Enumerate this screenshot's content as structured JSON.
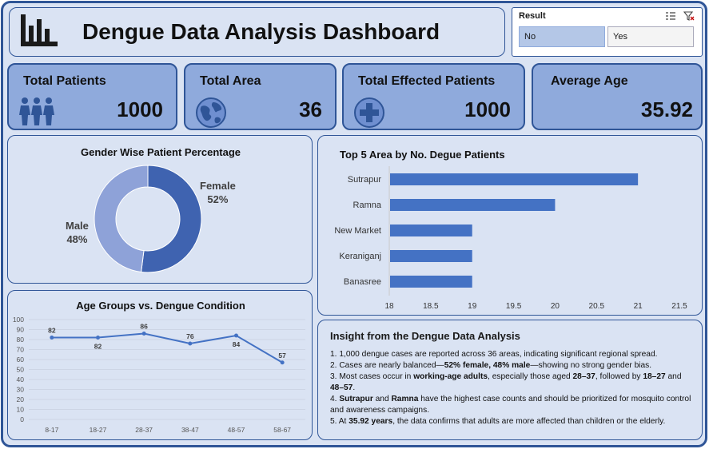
{
  "header": {
    "title": "Dengue Data Analysis Dashboard",
    "icon": "bar-chart-icon"
  },
  "slicer": {
    "title": "Result",
    "options": [
      "No",
      "Yes"
    ],
    "selected": "No",
    "icons": [
      "multi-select-icon",
      "clear-filter-icon"
    ]
  },
  "kpis": [
    {
      "title": "Total Patients",
      "value": "1000",
      "icon": "people-icon"
    },
    {
      "title": "Total Area",
      "value": "36",
      "icon": "globe-icon"
    },
    {
      "title": "Total Effected Patients",
      "value": "1000",
      "icon": "medical-cross-icon"
    },
    {
      "title": "Average Age",
      "value": "35.92",
      "icon": ""
    }
  ],
  "colors": {
    "dark_blue": "#2f5597",
    "mid_blue": "#4472c4",
    "light_blue": "#8faadc",
    "pale_blue": "#dae3f3",
    "donut_female": "#3f63b0",
    "donut_male": "#8ea2d8"
  },
  "chart_data": [
    {
      "type": "pie",
      "subtype": "donut",
      "title": "Gender Wise Patient Percentage",
      "slices": [
        {
          "label": "Female",
          "value": 52,
          "display": "52%"
        },
        {
          "label": "Male",
          "value": 48,
          "display": "48%"
        }
      ]
    },
    {
      "type": "bar",
      "orientation": "horizontal",
      "title": "Top 5 Area by No. Degue Patients",
      "categories": [
        "Sutrapur",
        "Ramna",
        "New Market",
        "Keraniganj",
        "Banasree"
      ],
      "values": [
        21,
        20,
        19,
        19,
        19
      ],
      "xlim": [
        18,
        21.5
      ],
      "xticks": [
        "18",
        "18.5",
        "19",
        "19.5",
        "20",
        "20.5",
        "21",
        "21.5"
      ],
      "grid": false
    },
    {
      "type": "line",
      "title": "Age Groups vs. Dengue Condition",
      "categories": [
        "8-17",
        "18-27",
        "28-37",
        "38-47",
        "48-57",
        "58-67"
      ],
      "values": [
        82,
        82,
        86,
        76,
        84,
        57
      ],
      "ylim": [
        0,
        100
      ],
      "yticks": [
        "0",
        "10",
        "20",
        "30",
        "40",
        "50",
        "60",
        "70",
        "80",
        "90",
        "100"
      ],
      "grid": true
    }
  ],
  "insight": {
    "title": "Insight from the Dengue Data Analysis",
    "lines": [
      {
        "parts": [
          {
            "t": "1. 1,000 dengue cases are reported across 36 areas, indicating significant regional spread.",
            "b": false
          }
        ]
      },
      {
        "parts": [
          {
            "t": "2. Cases are nearly balanced—",
            "b": false
          },
          {
            "t": "52% female, 48% male",
            "b": true
          },
          {
            "t": "—showing no strong gender bias.",
            "b": false
          }
        ]
      },
      {
        "parts": [
          {
            "t": "3. Most cases occur in ",
            "b": false
          },
          {
            "t": "working-age adults",
            "b": true
          },
          {
            "t": ", especially those aged ",
            "b": false
          },
          {
            "t": "28–37",
            "b": true
          },
          {
            "t": ", followed by ",
            "b": false
          },
          {
            "t": "18–27",
            "b": true
          },
          {
            "t": " and ",
            "b": false
          },
          {
            "t": "48–57",
            "b": true
          },
          {
            "t": ".",
            "b": false
          }
        ]
      },
      {
        "parts": [
          {
            "t": "4. ",
            "b": false
          },
          {
            "t": "Sutrapur",
            "b": true
          },
          {
            "t": " and ",
            "b": false
          },
          {
            "t": "Ramna",
            "b": true
          },
          {
            "t": " have the highest case counts and should be prioritized for mosquito control and awareness campaigns.",
            "b": false
          }
        ]
      },
      {
        "parts": [
          {
            "t": "5. At ",
            "b": false
          },
          {
            "t": "35.92 years",
            "b": true
          },
          {
            "t": ", the data confirms that adults are more affected than children or the elderly.",
            "b": false
          }
        ]
      }
    ]
  }
}
